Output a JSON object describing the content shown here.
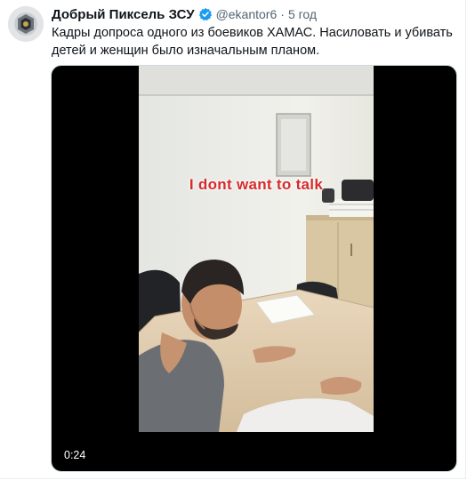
{
  "post": {
    "author_name": "Добрый Пиксель ЗСУ",
    "handle": "@ekantor6",
    "separator": "·",
    "time": "5 год",
    "text": "Кадры допроса одного из боевиков ХАМАС. Насиловать и убивать детей и женщин было изначальным планом."
  },
  "video": {
    "subtitle": "I dont want to talk",
    "timestamp": "0:24"
  },
  "icons": {
    "verified": "verified-badge-icon",
    "avatar": "avatar-emblem"
  },
  "colors": {
    "verified": "#1d9bf0",
    "subtitle": "#d62a2a",
    "muted": "#536471"
  }
}
